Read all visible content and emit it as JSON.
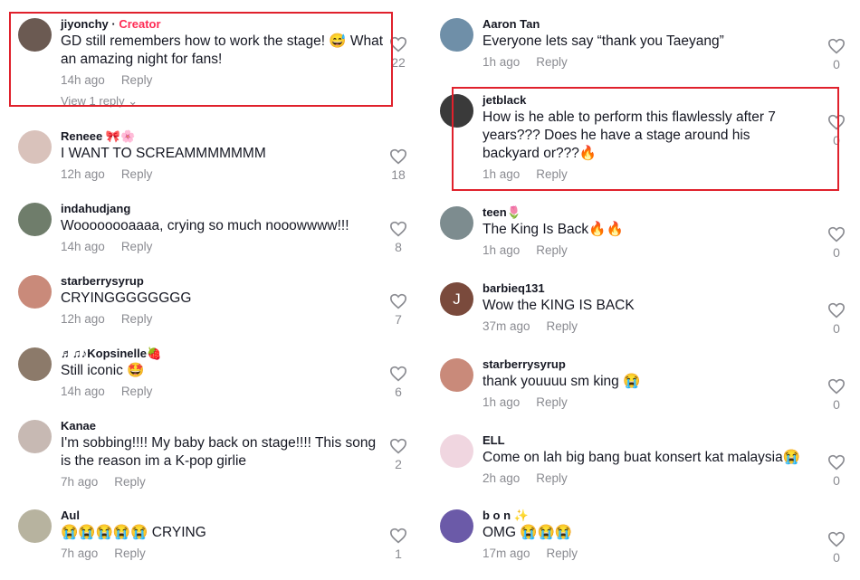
{
  "left_comments": [
    {
      "user": "jiyonchy",
      "badge": "Creator",
      "text": "GD still remembers how to work the stage! 😅 What an amazing night for fans!",
      "time": "14h ago",
      "reply": "Reply",
      "likes": "22",
      "view_replies": "View 1 reply",
      "avatar_color": "#6b5a52"
    },
    {
      "user": "Reneee 🎀🌸",
      "text": "I WANT TO SCREAMMMMMMM",
      "time": "12h ago",
      "reply": "Reply",
      "likes": "18",
      "avatar_color": "#d9c2bb"
    },
    {
      "user": "indahudjang",
      "text": "Woooooooaaaa, crying so much nooowwww!!!",
      "time": "14h ago",
      "reply": "Reply",
      "likes": "8",
      "avatar_color": "#6f7d6b"
    },
    {
      "user": "starberrysyrup",
      "text": "CRYINGGGGGGGG",
      "time": "12h ago",
      "reply": "Reply",
      "likes": "7",
      "avatar_color": "#c98a7a"
    },
    {
      "user": "♬♫♪Kopsinelle🍓",
      "text": "Still iconic 🤩",
      "time": "14h ago",
      "reply": "Reply",
      "likes": "6",
      "avatar_color": "#8c7a6a"
    },
    {
      "user": "Kanae",
      "text": "I'm sobbing!!!! My baby back on stage!!!! This song is the reason im a K-pop girlie",
      "time": "7h ago",
      "reply": "Reply",
      "likes": "2",
      "avatar_color": "#c7b9b3"
    },
    {
      "user": "Aul",
      "text": "😭😭😭😭😭 CRYING",
      "time": "7h ago",
      "reply": "Reply",
      "likes": "1",
      "avatar_color": "#b7b39f"
    }
  ],
  "right_comments": [
    {
      "user": "Aaron Tan",
      "text": "Everyone lets say “thank you Taeyang”",
      "time": "1h ago",
      "reply": "Reply",
      "likes": "0",
      "avatar_color": "#6f8fa8"
    },
    {
      "user": "jetblack",
      "text": "How is he able to perform this flawlessly after 7 years??? Does he have a stage around his backyard or???🔥",
      "time": "1h ago",
      "reply": "Reply",
      "likes": "0",
      "avatar_color": "#3a3a3a"
    },
    {
      "user": "teen🌷",
      "text": "The King Is Back🔥🔥",
      "time": "1h ago",
      "reply": "Reply",
      "likes": "0",
      "avatar_color": "#7d8c8f"
    },
    {
      "user": "barbieq131",
      "text": "Wow the KING IS BACK",
      "time": "37m ago",
      "reply": "Reply",
      "likes": "0",
      "avatar_color": "#7a4a3c",
      "avatar_letter": "J"
    },
    {
      "user": "starberrysyrup",
      "text": "thank youuuu sm king 😭",
      "time": "1h ago",
      "reply": "Reply",
      "likes": "0",
      "avatar_color": "#c98a7a"
    },
    {
      "user": "ELL",
      "text": "Come on lah big bang buat konsert kat malaysia😭",
      "time": "2h ago",
      "reply": "Reply",
      "likes": "0",
      "avatar_color": "#f0d6e0"
    },
    {
      "user": "b o n ✨",
      "text": "OMG 😭😭😭",
      "time": "17m ago",
      "reply": "Reply",
      "likes": "0",
      "avatar_color": "#6b5aa8"
    }
  ],
  "colors": {
    "highlight": "#e0212c",
    "creator": "#fe2c55",
    "muted": "#8a8b91"
  }
}
